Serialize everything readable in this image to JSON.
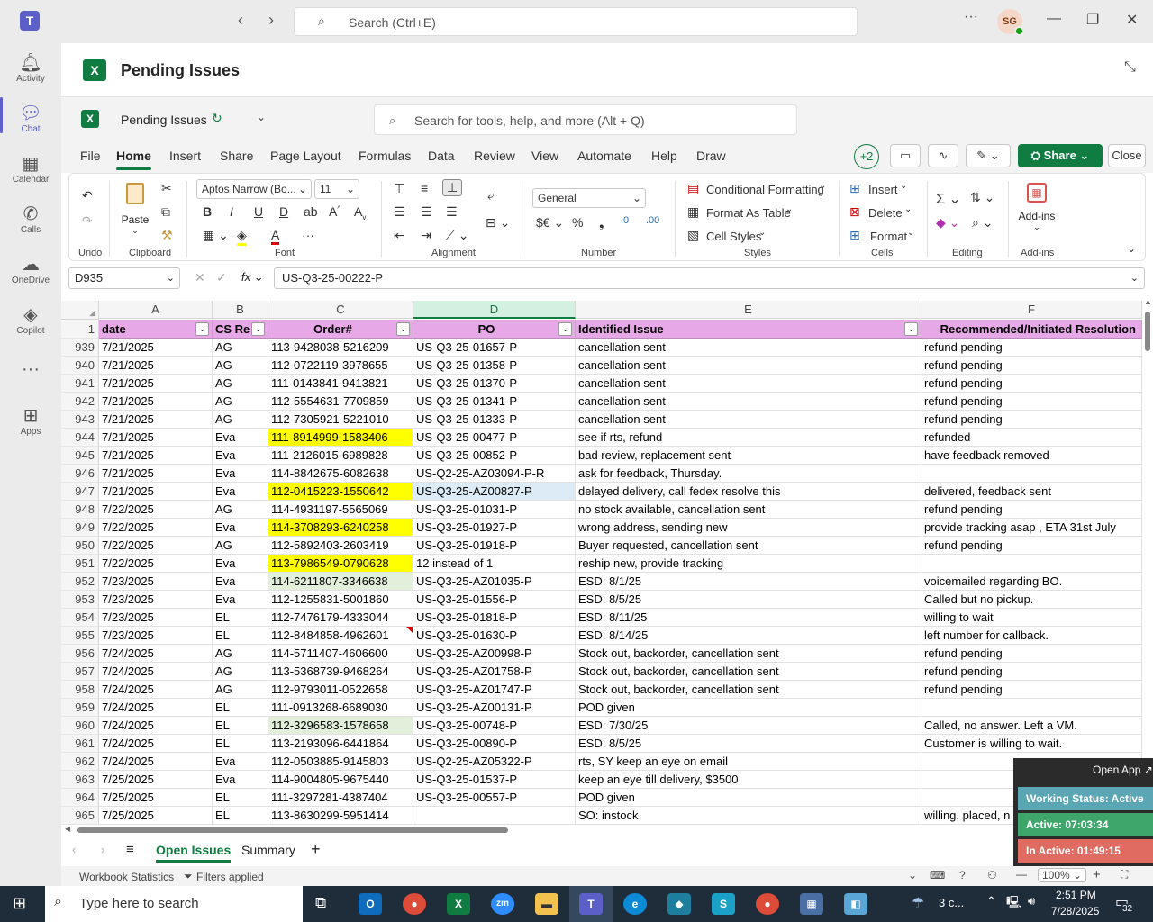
{
  "teams": {
    "search_placeholder": "Search (Ctrl+E)",
    "avatar_initials": "SG",
    "rail": [
      {
        "label": "Activity",
        "icon": "bell-icon"
      },
      {
        "label": "Chat",
        "icon": "chat-icon"
      },
      {
        "label": "Calendar",
        "icon": "calendar-icon"
      },
      {
        "label": "Calls",
        "icon": "phone-icon"
      },
      {
        "label": "OneDrive",
        "icon": "cloud-icon"
      },
      {
        "label": "Copilot",
        "icon": "copilot-icon"
      },
      {
        "label": "",
        "icon": "more-icon"
      },
      {
        "label": "Apps",
        "icon": "apps-icon"
      }
    ]
  },
  "app": {
    "title": "Pending Issues"
  },
  "workbook": {
    "name": "Pending Issues",
    "search_placeholder": "Search for tools, help, and more (Alt + Q)"
  },
  "menu": {
    "tabs": [
      "File",
      "Home",
      "Insert",
      "Share",
      "Page Layout",
      "Formulas",
      "Data",
      "Review",
      "View",
      "Automate",
      "Help",
      "Draw"
    ],
    "active": "Home",
    "collab_count": "+2",
    "share_label": "Share",
    "close_label": "Close"
  },
  "ribbon": {
    "undo_group": "Undo",
    "paste_label": "Paste",
    "clipboard_group": "Clipboard",
    "font_name": "Aptos Narrow (Bo...",
    "font_size": "11",
    "font_group": "Font",
    "alignment_group": "Alignment",
    "number_format": "General",
    "number_group": "Number",
    "conditional_formatting": "Conditional Formatting",
    "format_as_table": "Format As Table",
    "cell_styles": "Cell Styles",
    "styles_group": "Styles",
    "insert": "Insert",
    "delete": "Delete",
    "format": "Format",
    "cells_group": "Cells",
    "editing_group": "Editing",
    "addins_label": "Add-ins",
    "addins_group": "Add-ins"
  },
  "formula_bar": {
    "name_box": "D935",
    "formula": "US-Q3-25-00222-P"
  },
  "grid": {
    "columns": [
      "A",
      "B",
      "C",
      "D",
      "E",
      "F"
    ],
    "header_row_number": "1",
    "headers": [
      "date",
      "CS Re",
      "Order#",
      "PO",
      "Identified Issue",
      "Recommended/Initiated Resolution"
    ],
    "rows": [
      {
        "n": "939",
        "a": "7/21/2025",
        "b": "AG",
        "c": "113-9428038-5216209",
        "d": "US-Q3-25-01657-P",
        "e": "cancellation sent",
        "f": "refund pending"
      },
      {
        "n": "940",
        "a": "7/21/2025",
        "b": "AG",
        "c": "112-0722119-3978655",
        "d": "US-Q3-25-01358-P",
        "e": "cancellation sent",
        "f": "refund pending"
      },
      {
        "n": "941",
        "a": "7/21/2025",
        "b": "AG",
        "c": "111-0143841-9413821",
        "d": "US-Q3-25-01370-P",
        "e": "cancellation sent",
        "f": "refund pending"
      },
      {
        "n": "942",
        "a": "7/21/2025",
        "b": "AG",
        "c": "112-5554631-7709859",
        "d": "US-Q3-25-01341-P",
        "e": "cancellation sent",
        "f": "refund pending"
      },
      {
        "n": "943",
        "a": "7/21/2025",
        "b": "AG",
        "c": "112-7305921-5221010",
        "d": "US-Q3-25-01333-P",
        "e": "cancellation sent",
        "f": "refund pending"
      },
      {
        "n": "944",
        "a": "7/21/2025",
        "b": "Eva",
        "c": "111-8914999-1583406",
        "d": "US-Q3-25-00477-P",
        "e": "see if rts, refund",
        "f": "refunded",
        "c_fill": "yellow"
      },
      {
        "n": "945",
        "a": "7/21/2025",
        "b": "Eva",
        "c": "111-2126015-6989828",
        "d": "US-Q3-25-00852-P",
        "e": "bad review, replacement sent",
        "f": "have feedback removed"
      },
      {
        "n": "946",
        "a": "7/21/2025",
        "b": "Eva",
        "c": "114-8842675-6082638",
        "d": "US-Q2-25-AZ03094-P-R",
        "e": "ask for feedback, Thursday.",
        "f": ""
      },
      {
        "n": "947",
        "a": "7/21/2025",
        "b": "Eva",
        "c": "112-0415223-1550642",
        "d": "US-Q3-25-AZ00827-P",
        "e": "delayed delivery, call fedex resolve this",
        "f": "delivered, feedback sent",
        "c_fill": "yellow",
        "d_fill": "blue"
      },
      {
        "n": "948",
        "a": "7/22/2025",
        "b": "AG",
        "c": "114-4931197-5565069",
        "d": "US-Q3-25-01031-P",
        "e": "no stock available, cancellation sent",
        "f": "refund pending"
      },
      {
        "n": "949",
        "a": "7/22/2025",
        "b": "Eva",
        "c": "114-3708293-6240258",
        "d": "US-Q3-25-01927-P",
        "e": "wrong address, sending new",
        "f": "provide tracking asap , ETA 31st July",
        "c_fill": "yellow"
      },
      {
        "n": "950",
        "a": "7/22/2025",
        "b": "AG",
        "c": "112-5892403-2603419",
        "d": "US-Q3-25-01918-P",
        "e": "Buyer requested, cancellation sent",
        "f": "refund pending"
      },
      {
        "n": "951",
        "a": "7/22/2025",
        "b": "Eva",
        "c": "113-7986549-0790628",
        "d": "12 instead of 1",
        "e": "reship new, provide tracking",
        "f": "",
        "c_fill": "yellow"
      },
      {
        "n": "952",
        "a": "7/23/2025",
        "b": "Eva",
        "c": "114-6211807-3346638",
        "d": "US-Q3-25-AZ01035-P",
        "e": " ESD: 8/1/25",
        "f": "voicemailed regarding BO.",
        "c_fill": "green"
      },
      {
        "n": "953",
        "a": "7/23/2025",
        "b": "Eva",
        "c": "112-1255831-5001860",
        "d": "US-Q3-25-01556-P",
        "e": "ESD:  8/5/25",
        "f": "Called but no pickup."
      },
      {
        "n": "954",
        "a": "7/23/2025",
        "b": "EL",
        "c": "112-7476179-4333044",
        "d": "US-Q3-25-01818-P",
        "e": "ESD: 8/11/25",
        "f": "willing to wait"
      },
      {
        "n": "955",
        "a": "7/23/2025",
        "b": "EL",
        "c": "112-8484858-4962601",
        "d": "US-Q3-25-01630-P",
        "e": " ESD: 8/14/25",
        "f": "left number for callback."
      },
      {
        "n": "956",
        "a": "7/24/2025",
        "b": "AG",
        "c": "114-5711407-4606600",
        "d": "US-Q3-25-AZ00998-P",
        "e": "Stock out, backorder, cancellation sent",
        "f": "refund pending"
      },
      {
        "n": "957",
        "a": "7/24/2025",
        "b": "AG",
        "c": "113-5368739-9468264",
        "d": "US-Q3-25-AZ01758-P",
        "e": "Stock out, backorder, cancellation sent",
        "f": "refund pending"
      },
      {
        "n": "958",
        "a": "7/24/2025",
        "b": "AG",
        "c": "112-9793011-0522658",
        "d": "US-Q3-25-AZ01747-P",
        "e": "Stock out, backorder, cancellation sent",
        "f": "refund pending"
      },
      {
        "n": "959",
        "a": "7/24/2025",
        "b": "EL",
        "c": "111-0913268-6689030",
        "d": "US-Q3-25-AZ00131-P",
        "e": "POD given",
        "f": ""
      },
      {
        "n": "960",
        "a": "7/24/2025",
        "b": "EL",
        "c": "112-3296583-1578658",
        "d": "US-Q3-25-00748-P",
        "e": "ESD: 7/30/25",
        "f": "Called, no answer. Left a VM.",
        "c_fill": "green"
      },
      {
        "n": "961",
        "a": "7/24/2025",
        "b": "EL",
        "c": "113-2193096-6441864",
        "d": "US-Q3-25-00890-P",
        "e": "ESD: 8/5/25",
        "f": "Customer is willing to wait."
      },
      {
        "n": "962",
        "a": "7/24/2025",
        "b": "Eva",
        "c": "112-0503885-9145803",
        "d": "US-Q2-25-AZ05322-P",
        "e": "rts, SY keep an eye on email",
        "f": ""
      },
      {
        "n": "963",
        "a": "7/25/2025",
        "b": "Eva",
        "c": "114-9004805-9675440",
        "d": "US-Q3-25-01537-P",
        "e": "keep an eye till delivery, $3500",
        "f": ""
      },
      {
        "n": "964",
        "a": "7/25/2025",
        "b": "EL",
        "c": "111-3297281-4387404",
        "d": "US-Q3-25-00557-P",
        "e": "POD given",
        "f": ""
      },
      {
        "n": "965",
        "a": "7/25/2025",
        "b": "EL",
        "c": "113-8630299-5951414",
        "d": "",
        "e": "SO: instock",
        "f": "willing, placed, n"
      }
    ]
  },
  "sheets": {
    "tabs": [
      "Open Issues",
      "Summary"
    ],
    "active": "Open Issues"
  },
  "status": {
    "stats": "Workbook Statistics",
    "filters": "Filters applied",
    "zoom": "100%"
  },
  "widget": {
    "open_app": "Open App ↗",
    "status": "Working Status: Active",
    "active": "Active: 07:03:34",
    "inactive": "In Active: 01:49:15"
  },
  "taskbar": {
    "search_placeholder": "Type here to search",
    "weather": "3 c...",
    "time": "2:51 PM",
    "date": "7/28/2025",
    "notifications": "32"
  },
  "colors": {
    "excel_green": "#107c41",
    "teams_purple": "#5b5fc7",
    "header_fill": "#e6a8e6",
    "highlight_yellow": "#ffff00"
  }
}
